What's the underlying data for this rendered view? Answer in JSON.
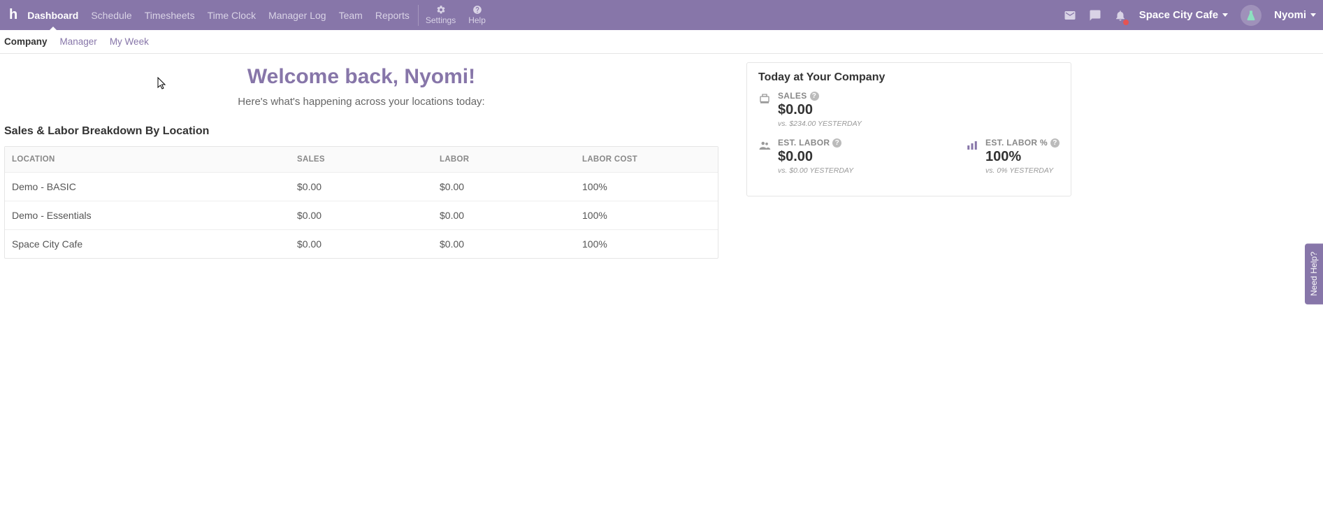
{
  "nav": {
    "logo": "h",
    "items": [
      "Dashboard",
      "Schedule",
      "Timesheets",
      "Time Clock",
      "Manager Log",
      "Team",
      "Reports"
    ],
    "active_index": 0,
    "settings": "Settings",
    "help": "Help",
    "company": "Space City Cafe",
    "user": "Nyomi"
  },
  "subnav": {
    "items": [
      "Company",
      "Manager",
      "My Week"
    ],
    "active_index": 0
  },
  "welcome": {
    "title": "Welcome back, Nyomi!",
    "subtitle": "Here's what's happening across your locations today:"
  },
  "table": {
    "title": "Sales & Labor Breakdown By Location",
    "headers": [
      "LOCATION",
      "SALES",
      "LABOR",
      "LABOR COST"
    ],
    "rows": [
      {
        "location": "Demo - BASIC",
        "sales": "$0.00",
        "labor": "$0.00",
        "labor_cost": "100%"
      },
      {
        "location": "Demo - Essentials",
        "sales": "$0.00",
        "labor": "$0.00",
        "labor_cost": "100%"
      },
      {
        "location": "Space City Cafe",
        "sales": "$0.00",
        "labor": "$0.00",
        "labor_cost": "100%"
      }
    ]
  },
  "today": {
    "title": "Today at Your Company",
    "sales": {
      "label": "SALES",
      "value": "$0.00",
      "sub": "vs. $234.00 YESTERDAY"
    },
    "est_labor": {
      "label": "EST. LABOR",
      "value": "$0.00",
      "sub": "vs. $0.00 YESTERDAY"
    },
    "est_labor_pct": {
      "label": "EST. LABOR %",
      "value": "100%",
      "sub": "vs. 0% YESTERDAY"
    }
  },
  "helptab": "Need Help?"
}
